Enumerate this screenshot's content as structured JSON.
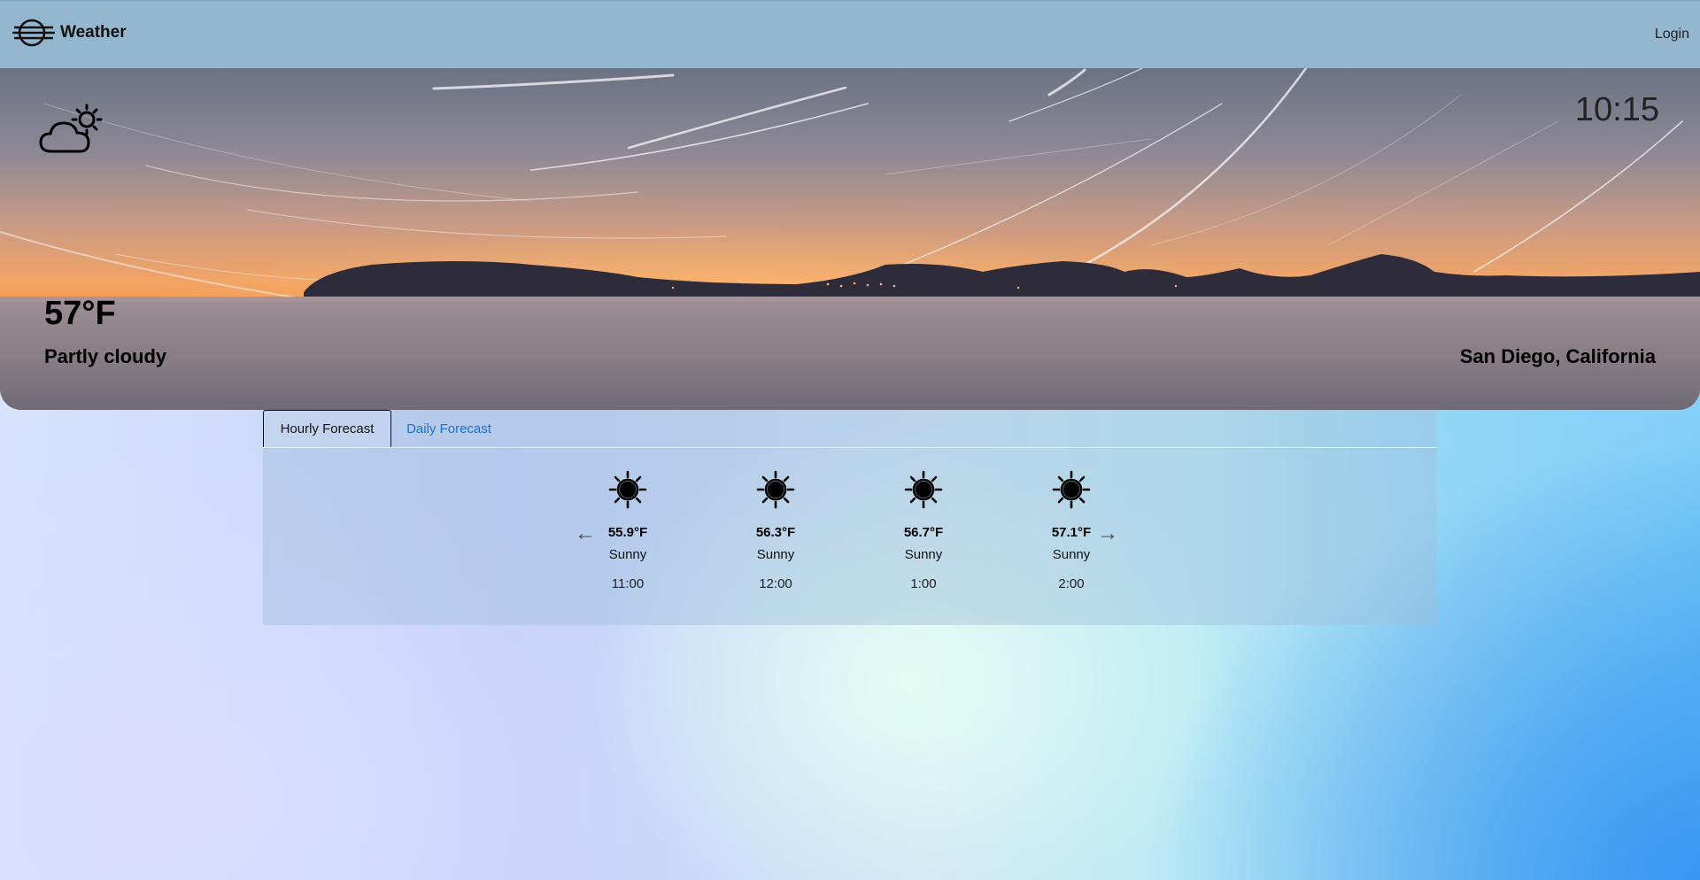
{
  "navbar": {
    "brand": "Weather",
    "login": "Login",
    "logo_icon": "weather-logo-icon"
  },
  "hero": {
    "time": "10:15",
    "temperature": "57°F",
    "condition": "Partly cloudy",
    "location": "San Diego, California",
    "icon": "partly-cloudy-icon"
  },
  "forecast": {
    "tabs": [
      {
        "label": "Hourly Forecast",
        "active": true
      },
      {
        "label": "Daily Forecast",
        "active": false
      }
    ],
    "prev_arrow": "←",
    "next_arrow": "→",
    "hours": [
      {
        "temp": "55.9°F",
        "condition": "Sunny",
        "time": "11:00",
        "icon": "sun-icon"
      },
      {
        "temp": "56.3°F",
        "condition": "Sunny",
        "time": "12:00",
        "icon": "sun-icon"
      },
      {
        "temp": "56.7°F",
        "condition": "Sunny",
        "time": "1:00",
        "icon": "sun-icon"
      },
      {
        "temp": "57.1°F",
        "condition": "Sunny",
        "time": "2:00",
        "icon": "sun-icon"
      }
    ]
  },
  "colors": {
    "navbar": "#94b6cf",
    "tab_link": "#1d6fd6"
  }
}
